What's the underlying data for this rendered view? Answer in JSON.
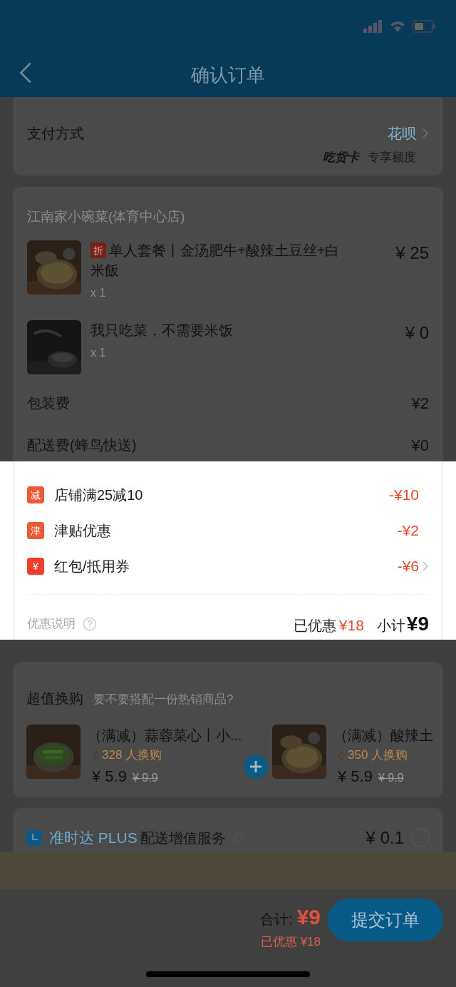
{
  "header": {
    "title": "确认订单"
  },
  "payment": {
    "label": "支付方式",
    "method": "花呗",
    "card_brand": "吃货卡",
    "card_note": "专享额度"
  },
  "shop": {
    "name": "江南家小碗菜(体育中心店)",
    "items": [
      {
        "tag": "折",
        "name": "单人套餐丨金汤肥牛+酸辣土豆丝+白米飯",
        "quantity": "x 1",
        "price": "¥ 25"
      },
      {
        "name": "我只吃菜，不需要米饭",
        "quantity": "x 1",
        "price": "¥ 0"
      }
    ],
    "fees": [
      {
        "label": "包装费",
        "amount": "¥2"
      },
      {
        "label": "配送费(蜂鸟快送)",
        "amount": "¥0"
      }
    ]
  },
  "discounts": {
    "rows": [
      {
        "badge": "减",
        "label": "店铺满25减10",
        "amount": "-¥10",
        "chevron": false
      },
      {
        "badge": "津",
        "label": "津贴优惠",
        "amount": "-¥2",
        "chevron": false
      },
      {
        "badge": "¥",
        "label": "红包/抵用券",
        "amount": "-¥6",
        "chevron": true
      }
    ],
    "note": "优惠说明",
    "saved_label": "已优惠",
    "saved": "¥18",
    "subtotal_label": "小计",
    "subtotal": "¥9"
  },
  "exchange": {
    "title": "超值换购",
    "subtitle": "要不要搭配一份热销商品?",
    "items": [
      {
        "name": "（满减）蒜蓉菜心丨小...",
        "buyers": "328 人换购",
        "price": "¥ 5.9",
        "original": "¥ 9.9"
      },
      {
        "name": "（满减）酸辣土",
        "buyers": "350 人换购",
        "price": "¥ 5.9",
        "original": "¥ 9.9"
      }
    ]
  },
  "ontime": {
    "brand": "准时达 PLUS",
    "label": "配送增值服务",
    "price": "¥ 0.1",
    "selected": false
  },
  "footer": {
    "total_label": "合计:",
    "total": "¥9",
    "saved": "已优惠 ¥18",
    "submit": "提交订单"
  }
}
